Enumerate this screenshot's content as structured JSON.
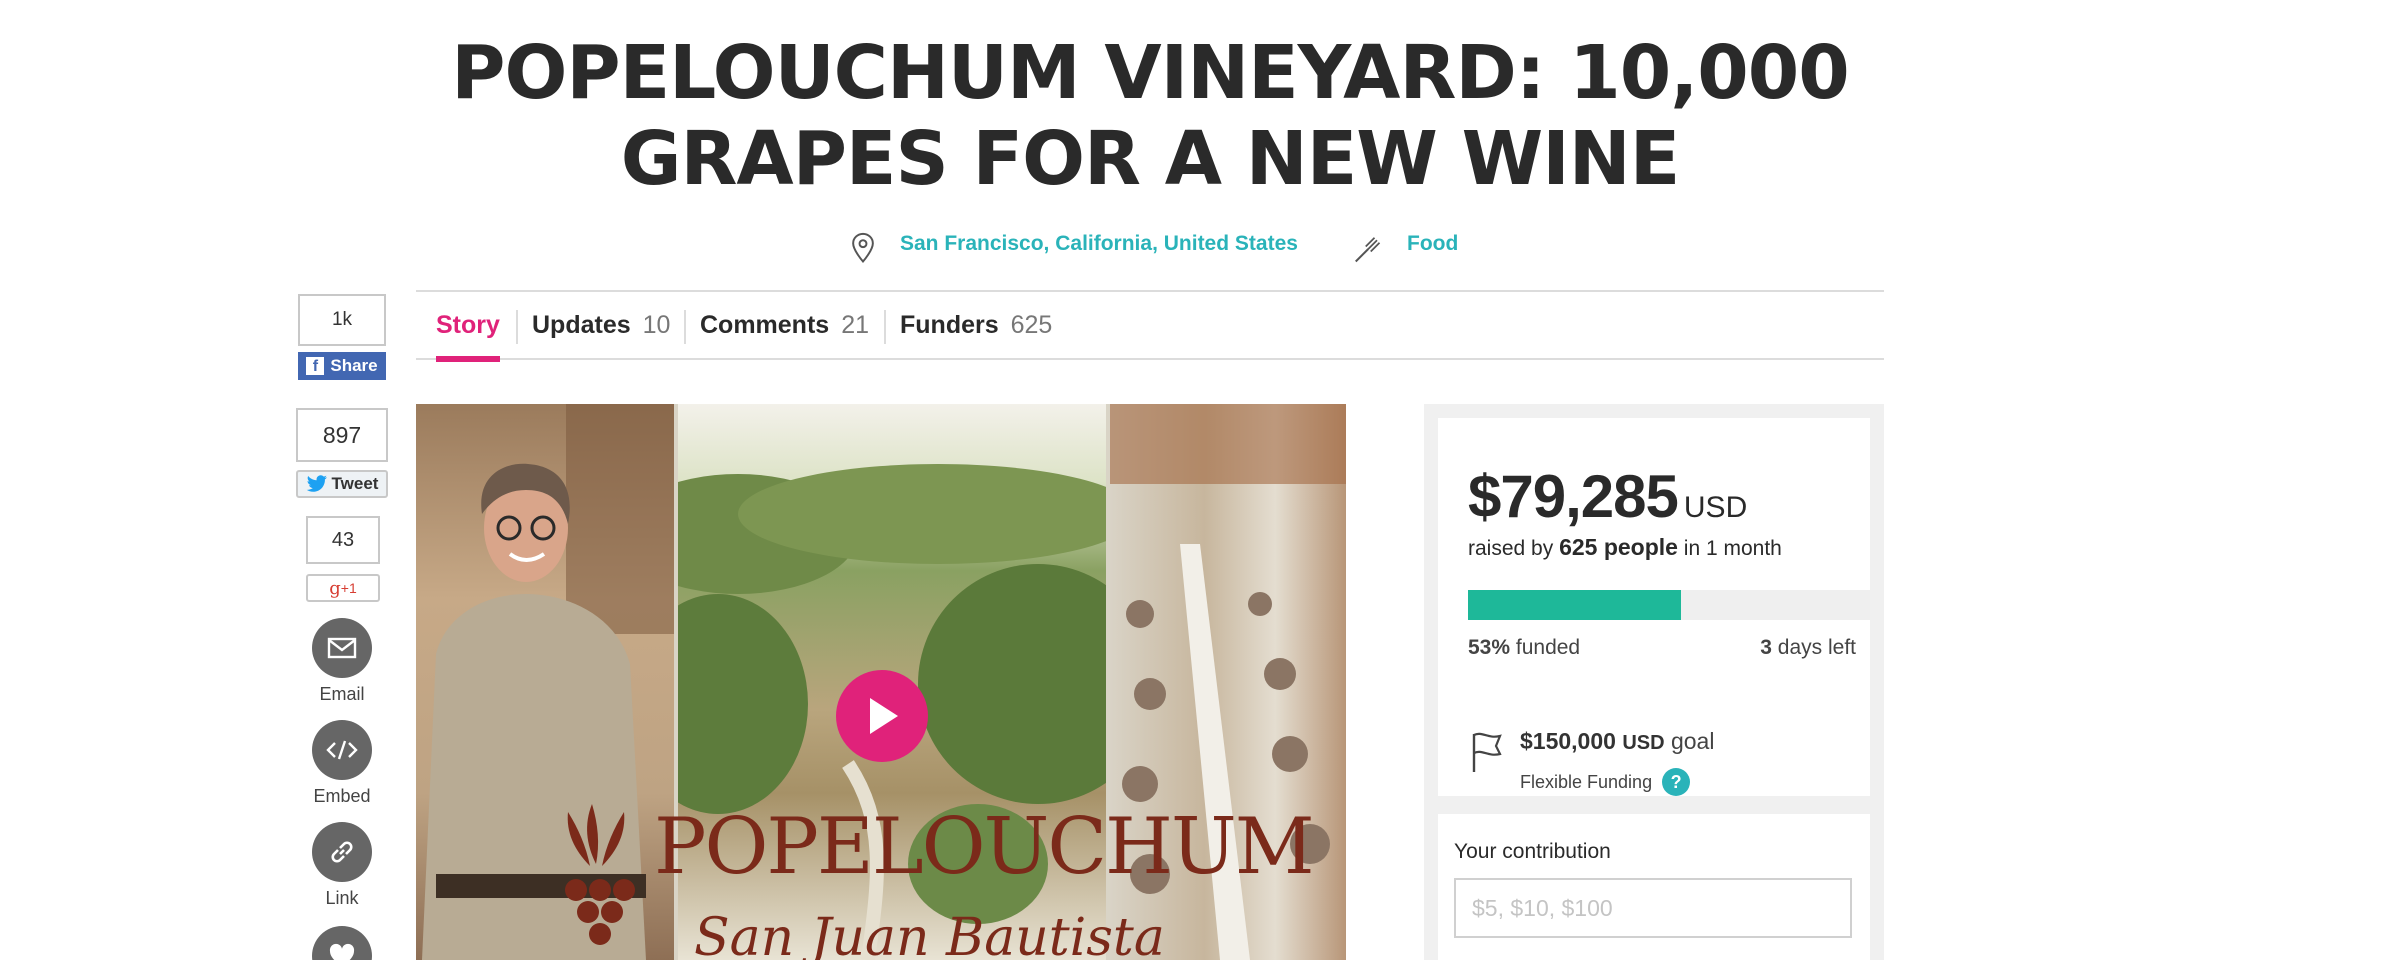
{
  "campaign": {
    "title": "POPELOUCHUM VINEYARD: 10,000 GRAPES FOR A NEW WINE",
    "location": "San Francisco, California, United States",
    "category": "Food"
  },
  "tabs": [
    {
      "label": "Story",
      "count": ""
    },
    {
      "label": "Updates",
      "count": "10"
    },
    {
      "label": "Comments",
      "count": "21"
    },
    {
      "label": "Funders",
      "count": "625"
    }
  ],
  "social": {
    "facebook": {
      "count": "1k",
      "label": "Share"
    },
    "twitter": {
      "count": "897",
      "label": "Tweet"
    },
    "googleplus": {
      "count": "43",
      "label": "+1"
    },
    "email_label": "Email",
    "embed_label": "Embed",
    "link_label": "Link"
  },
  "video": {
    "logo_text": "POPELOUCHUM",
    "logo_subtext": "San Juan Bautista"
  },
  "funding": {
    "amount": "$79,285",
    "currency": "USD",
    "raised_prefix": "raised by",
    "people": "625 people",
    "period": "in 1 month",
    "percent_funded": 53,
    "funded_value": "53%",
    "funded_label": "funded",
    "days_left_value": "3",
    "days_left_label": "days left",
    "goal_amount": "$150,000",
    "goal_currency": "USD",
    "goal_label": "goal",
    "funding_type": "Flexible Funding",
    "help_icon_text": "?"
  },
  "contribution": {
    "label": "Your contribution",
    "placeholder": "$5, $10, $100"
  },
  "colors": {
    "accent_pink": "#e0227a",
    "teal_link": "#2ab3b9",
    "progress_green": "#1eb899",
    "facebook_blue": "#4267b2"
  }
}
